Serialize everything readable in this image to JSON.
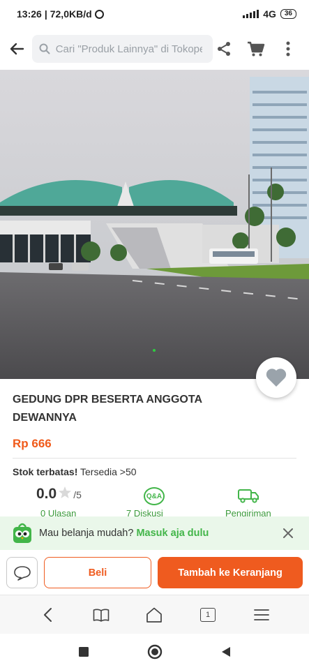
{
  "status_bar": {
    "time": "13:26",
    "network_speed": "72,0KB/d",
    "network_type": "4G",
    "battery": "36"
  },
  "topbar": {
    "search_placeholder": "Cari \"Produk Lainnya\" di Tokopedia",
    "icons": [
      "back-arrow-icon",
      "search-icon",
      "share-icon",
      "cart-icon",
      "more-vertical-icon"
    ]
  },
  "product": {
    "title": "GEDUNG DPR BESERTA ANGGOTA DEWANNYA",
    "price": "Rp 666",
    "stock_bold": "Stok terbatas!",
    "stock_text": "Tersedia >50"
  },
  "stats": {
    "rating": "0.0",
    "rating_max": "/5",
    "reviews_label": "0 Ulasan",
    "qa_badge": "Q&A",
    "discussion_label": "7 Diskusi",
    "shipping_label": "Pengiriman"
  },
  "login_banner": {
    "text": "Mau belanja mudah?",
    "link": "Masuk aja dulu"
  },
  "actions": {
    "buy": "Beli",
    "add_to_cart": "Tambah ke Keranjang"
  },
  "browser_nav": {
    "tab_count": "1"
  },
  "colors": {
    "brand_orange": "#ef5b1f",
    "brand_green": "#42b549"
  }
}
